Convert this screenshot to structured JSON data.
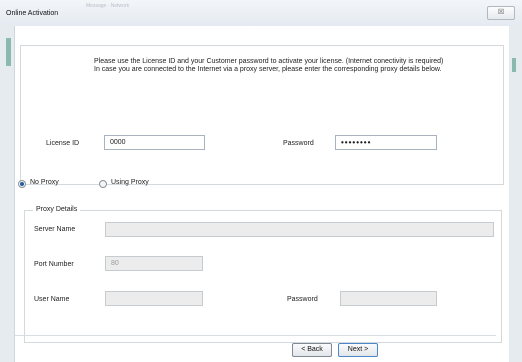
{
  "window": {
    "title": "Online Activation",
    "background_title": "Message · Network"
  },
  "info": {
    "line1": "Please use the License ID and your Customer password to activate your license. (Internet conectivity is required)",
    "line2": "In case you are connected to the Internet via a proxy server, please enter the corresponding proxy details below."
  },
  "license": {
    "id_label": "License ID",
    "id_value": "0000",
    "password_label": "Password",
    "password_value": "••••••••"
  },
  "proxy_mode": {
    "no_proxy_label": "No Proxy",
    "using_proxy_label": "Using Proxy",
    "selected": "No Proxy"
  },
  "proxy_details": {
    "legend": "Proxy Details",
    "server_name_label": "Server Name",
    "server_name_value": "",
    "port_label": "Port Number",
    "port_value": "80",
    "user_label": "User Name",
    "user_value": "",
    "password_label": "Password",
    "password_value": ""
  },
  "buttons": {
    "back": "< Back",
    "next": "Next >",
    "close": "☒"
  }
}
